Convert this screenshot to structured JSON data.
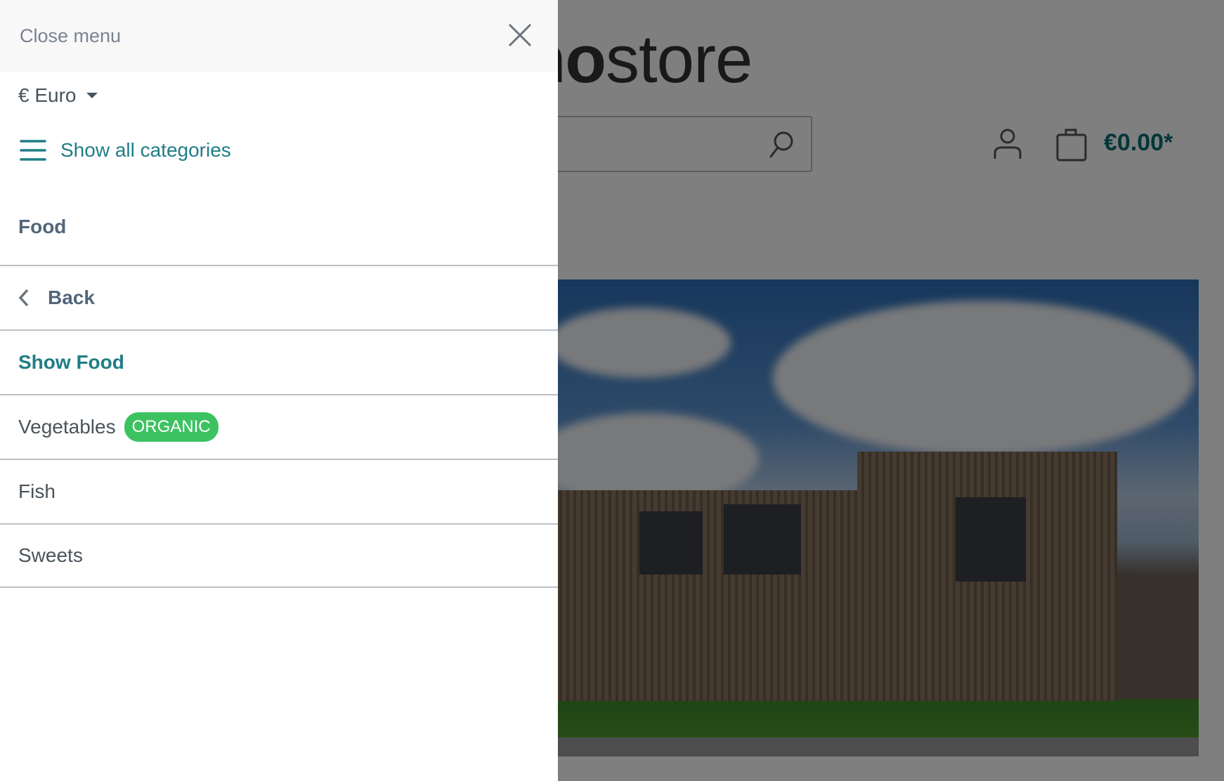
{
  "header": {
    "logo_bold": "mo",
    "logo_light": "store",
    "cart_total": "€0.00*"
  },
  "menu": {
    "close_label": "Close menu",
    "currency": "€ Euro",
    "show_all_categories": "Show all categories",
    "current_category": "Food",
    "back_label": "Back",
    "show_category_label": "Show Food",
    "items": [
      {
        "label": "Vegetables",
        "badge": "ORGANIC"
      },
      {
        "label": "Fish"
      },
      {
        "label": "Sweets"
      }
    ]
  },
  "colors": {
    "accent": "#1f7d85",
    "badge": "#3cc261",
    "heading": "#52667a"
  }
}
